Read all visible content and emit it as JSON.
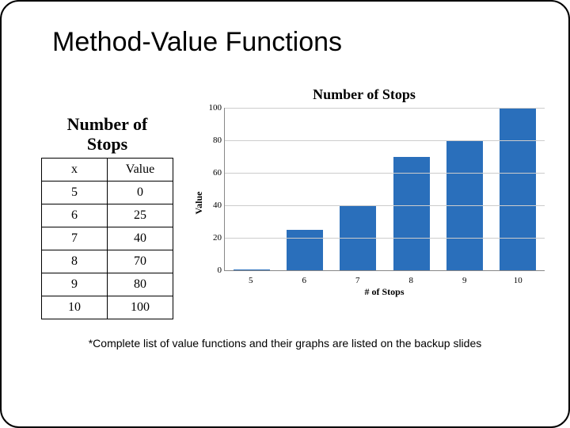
{
  "title": "Method-Value Functions",
  "table": {
    "caption_line1": "Number of",
    "caption_line2": "Stops",
    "header_x": "x",
    "header_value": "Value",
    "rows": [
      {
        "x": "5",
        "value": "0"
      },
      {
        "x": "6",
        "value": "25"
      },
      {
        "x": "7",
        "value": "40"
      },
      {
        "x": "8",
        "value": "70"
      },
      {
        "x": "9",
        "value": "80"
      },
      {
        "x": "10",
        "value": "100"
      }
    ]
  },
  "chart_data": {
    "type": "bar",
    "title": "Number of Stops",
    "xlabel": "# of Stops",
    "ylabel": "Value",
    "categories": [
      "5",
      "6",
      "7",
      "8",
      "9",
      "10"
    ],
    "values": [
      0,
      25,
      40,
      70,
      80,
      100
    ],
    "ylim": [
      0,
      100
    ],
    "yticks": [
      0,
      20,
      40,
      60,
      80,
      100
    ]
  },
  "footnote": "*Complete list of value functions and their graphs are listed on the backup slides"
}
